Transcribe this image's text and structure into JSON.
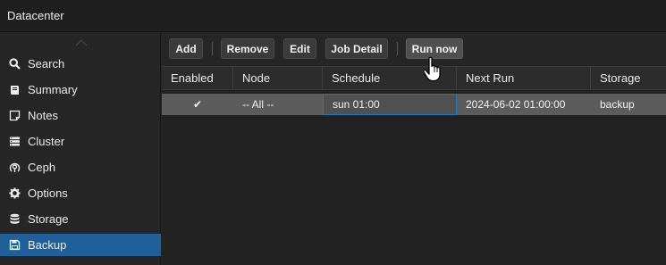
{
  "window": {
    "title": "Datacenter"
  },
  "sidebar": {
    "items": [
      {
        "label": "Search",
        "icon": "search-icon"
      },
      {
        "label": "Summary",
        "icon": "book-icon"
      },
      {
        "label": "Notes",
        "icon": "note-icon"
      },
      {
        "label": "Cluster",
        "icon": "server-icon"
      },
      {
        "label": "Ceph",
        "icon": "ceph-icon"
      },
      {
        "label": "Options",
        "icon": "gear-icon"
      },
      {
        "label": "Storage",
        "icon": "database-icon"
      },
      {
        "label": "Backup",
        "icon": "floppy-icon",
        "active": true
      }
    ]
  },
  "toolbar": {
    "add": "Add",
    "remove": "Remove",
    "edit": "Edit",
    "job_detail": "Job Detail",
    "run_now": "Run now"
  },
  "grid": {
    "columns": [
      "Enabled",
      "Node",
      "Schedule",
      "Next Run",
      "Storage"
    ],
    "rows": [
      {
        "enabled": "✔",
        "node": "-- All --",
        "schedule": "sun 01:00",
        "next_run": "2024-06-02 01:00:00",
        "storage": "backup"
      }
    ]
  },
  "colors": {
    "accent": "#1f5f9a",
    "selected_row": "#5c5c5c"
  }
}
